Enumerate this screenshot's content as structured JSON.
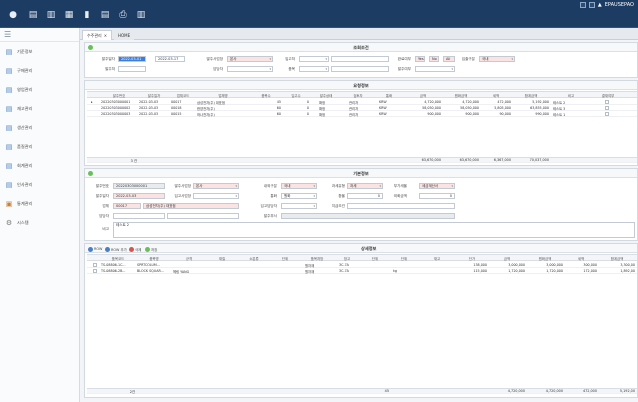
{
  "topbar": {
    "icons": [
      "home-icon",
      "new-doc-icon",
      "save-doc-icon",
      "save-icon",
      "delete-icon",
      "copy-doc-icon",
      "print-icon",
      "export-icon"
    ],
    "user": "EPAUSEPAO"
  },
  "sidebar": {
    "items": [
      {
        "label": "기준정보",
        "icon": "doc-icon",
        "color": "#4a7fc1"
      },
      {
        "label": "구매관리",
        "icon": "doc-icon",
        "color": "#4a7fc1"
      },
      {
        "label": "영업관리",
        "icon": "doc-icon",
        "color": "#4a7fc1"
      },
      {
        "label": "재고관리",
        "icon": "doc-icon",
        "color": "#4a7fc1"
      },
      {
        "label": "생산관리",
        "icon": "doc-icon",
        "color": "#4a7fc1"
      },
      {
        "label": "품질관리",
        "icon": "doc-icon",
        "color": "#4a7fc1"
      },
      {
        "label": "회계관리",
        "icon": "doc-icon",
        "color": "#4a7fc1"
      },
      {
        "label": "인사관리",
        "icon": "doc-icon",
        "color": "#4a7fc1"
      },
      {
        "label": "통계관리",
        "icon": "chart-icon",
        "color": "#4a7fc1"
      },
      {
        "label": "시스템",
        "icon": "gear-icon",
        "color": "#777777"
      }
    ]
  },
  "tabs": {
    "active": "수주관리",
    "home": "HOME"
  },
  "search": {
    "title": "조회조건",
    "labels": {
      "date": "발주일자",
      "supplier": "발주처",
      "buyer": "발주사업장",
      "warehouse": "입고처",
      "item": "품목",
      "status": "완료여부",
      "dept": "담당자",
      "type": "입출구분",
      "yn": "발주여부"
    },
    "values": {
      "date_from": "2022-03-01",
      "date_to": "2022-03-17",
      "buyer": "본사",
      "status_a": "Yes",
      "status_b": "No",
      "status_c": "All",
      "type": "국내"
    }
  },
  "list": {
    "title": "요청정보",
    "columns": [
      "발주번호",
      "발주일자",
      "업체코드",
      "업체명",
      "품목수",
      "입고수",
      "발주상태",
      "검토자",
      "통화",
      "금액",
      "원화금액",
      "세액",
      "합계금액",
      "비고",
      "결재여부"
    ],
    "rows": [
      [
        "20220303000001",
        "2022-03-03",
        "00017",
        "삼성전자(주) 대표점",
        "45",
        "0",
        "확정",
        "관리자",
        "KRW",
        "4,720,000",
        "4,720,000",
        "472,000",
        "5,192,000",
        "테스트 2",
        ""
      ],
      [
        "20220303000002",
        "2022-03-03",
        "00018",
        "한양전자(주)",
        "60",
        "0",
        "확정",
        "관리자",
        "KRW",
        "58,050,000",
        "58,050,000",
        "5,805,000",
        "63,855,000",
        "테스트 3",
        ""
      ],
      [
        "20220303000003",
        "2022-03-03",
        "00015",
        "하나전자(주)",
        "60",
        "0",
        "확정",
        "관리자",
        "KRW",
        "900,000",
        "900,000",
        "90,000",
        "990,000",
        "테스트 1",
        ""
      ]
    ],
    "footer": {
      "count": "3 건",
      "amount": "63,670,000",
      "krw": "63,670,000",
      "tax": "6,367,000",
      "total": "70,037,000"
    }
  },
  "detail": {
    "title": "기본정보",
    "labels": {
      "no": "발주번호",
      "place": "발주사업장",
      "category": "내외구분",
      "rate": "과세유형",
      "vat": "부가세율",
      "date": "발주일자",
      "inbound": "입고사업장",
      "currency": "통화",
      "exchange": "환율",
      "ext": "외화금액",
      "vendor": "업체",
      "buyer": "입고담당자",
      "payment": "지급조건",
      "code": "담당자",
      "memo": "비고",
      "dept": "발주부서"
    },
    "values": {
      "no": "20220303000001",
      "place": "본사",
      "category": "국내",
      "rate": "과세",
      "vat": "세금계산서",
      "date": "2022-03-03",
      "currency": "원화",
      "exchange": "0",
      "ext": "0",
      "vendor_code": "00017",
      "vendor_name": "삼성전자(주) 대표점",
      "memo": "테스트 2"
    }
  },
  "items": {
    "title": "상세정보",
    "buttons": [
      "ROW",
      "ROW 추가",
      "삭제",
      "저장"
    ],
    "columns": [
      "품목코드",
      "품목명",
      "규격",
      "재질",
      "소분류",
      "단위",
      "품목처방",
      "창고",
      "단위",
      "단위",
      "재고",
      "단가",
      "금액",
      "원화금액",
      "세액",
      "합계금액"
    ],
    "rows": [
      [
        "TS-08806-1C...",
        "SPRTCOLUM...",
        "",
        "",
        "",
        "",
        "원자재",
        "3C-7A",
        "",
        "",
        "",
        "138,000",
        "3,000,000",
        "3,000,000",
        "300,000",
        "3,300,00"
      ],
      [
        "TS-08806-2B...",
        "BLOCK SQUAR...",
        "헤링 YANG",
        "",
        "",
        "",
        "원자재",
        "3C-7A",
        "",
        "kg",
        "",
        "115,000",
        "1,720,000",
        "1,720,000",
        "172,000",
        "1,892,00"
      ]
    ],
    "footer": {
      "count": "2건",
      "qty": "45",
      "amount": "4,720,000",
      "krw": "4,720,000",
      "tax": "472,000",
      "total": "5,192,00"
    }
  }
}
